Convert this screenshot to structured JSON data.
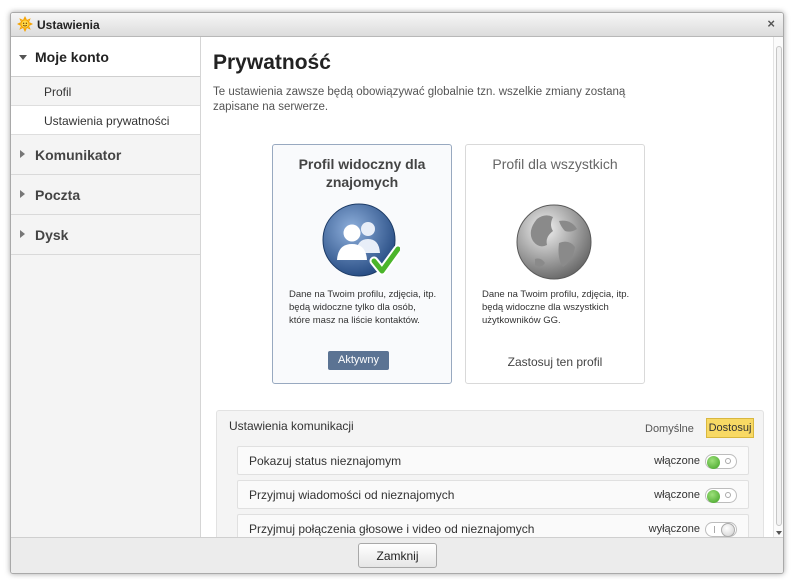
{
  "window": {
    "title": "Ustawienia",
    "app_icon": "sun-icon",
    "close_glyph": "×"
  },
  "sidebar": {
    "groups": [
      {
        "label": "Moje konto",
        "expanded": true,
        "items": [
          {
            "label": "Profil",
            "active": false
          },
          {
            "label": "Ustawienia prywatności",
            "active": true
          }
        ]
      },
      {
        "label": "Komunikator",
        "expanded": false
      },
      {
        "label": "Poczta",
        "expanded": false
      },
      {
        "label": "Dysk",
        "expanded": false
      }
    ]
  },
  "main": {
    "title": "Prywatność",
    "description": "Te ustawienia zawsze będą obowiązywać globalnie tzn. wszelkie zmiany zostaną zapisane na serwerze.",
    "cards": [
      {
        "title": "Profil widoczny dla znajomych",
        "icon": "contacts-check-icon",
        "text": "Dane na Twoim profilu, zdjęcia, itp. będą widoczne tylko dla osób, które masz na liście kontaktów.",
        "button": "Aktywny"
      },
      {
        "title": "Profil dla wszystkich",
        "icon": "globe-icon",
        "text": "Dane na Twoim profilu, zdjęcia, itp. będą widoczne dla wszystkich użytkowników GG.",
        "link": "Zastosuj ten profil"
      }
    ],
    "communication": {
      "title": "Ustawienia komunikacji",
      "default_label": "Domyślne",
      "custom_label": "Dostosuj",
      "rows": [
        {
          "label": "Pokazuj status nieznajomym",
          "state": "włączone",
          "on": true
        },
        {
          "label": "Przyjmuj wiadomości od nieznajomych",
          "state": "włączone",
          "on": true
        },
        {
          "label": "Przyjmuj połączenia głosowe i video od nieznajomych",
          "state": "wyłączone",
          "on": false
        }
      ]
    }
  },
  "footer": {
    "close_label": "Zamknij"
  },
  "colors": {
    "accent_button": "#5b7393",
    "custom_highlight": "#f8d964",
    "toggle_on": "#3fa123"
  }
}
